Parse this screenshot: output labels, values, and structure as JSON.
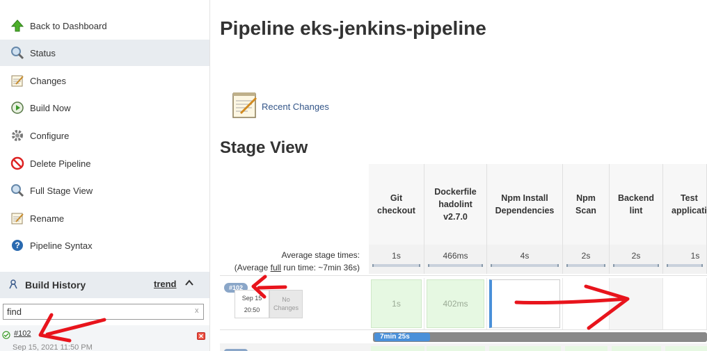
{
  "sidebar": {
    "items": [
      {
        "label": "Back to Dashboard",
        "icon": "up-arrow-icon"
      },
      {
        "label": "Status",
        "icon": "magnifier-icon"
      },
      {
        "label": "Changes",
        "icon": "notepad-icon"
      },
      {
        "label": "Build Now",
        "icon": "clock-play-icon"
      },
      {
        "label": "Configure",
        "icon": "gear-icon"
      },
      {
        "label": "Delete Pipeline",
        "icon": "no-entry-icon"
      },
      {
        "label": "Full Stage View",
        "icon": "magnifier-icon"
      },
      {
        "label": "Rename",
        "icon": "notepad-icon"
      },
      {
        "label": "Pipeline Syntax",
        "icon": "help-icon"
      }
    ],
    "build_history": {
      "title": "Build History",
      "trend": "trend",
      "find_value": "find",
      "find_clear": "x",
      "build_link": "#102",
      "build_date": "Sep 15, 2021 11:50 PM"
    }
  },
  "main": {
    "title": "Pipeline eks-jenkins-pipeline",
    "recent_changes": "Recent Changes",
    "stage_view_title": "Stage View",
    "avg_stage_times_label": "Average stage times:",
    "avg_run_prefix": "(Average ",
    "avg_run_full": "full",
    "avg_run_suffix": " run time: ~7min 36s)",
    "stages": [
      {
        "name": "Git\ncheckout",
        "avg": "1s",
        "cell": "1s",
        "state": "success"
      },
      {
        "name": "Dockerfile\nhadolint\nv2.7.0",
        "avg": "466ms",
        "cell": "402ms",
        "state": "success"
      },
      {
        "name": "Npm Install\nDependencies",
        "avg": "4s",
        "cell": "",
        "state": "running"
      },
      {
        "name": "Npm\nScan",
        "avg": "2s",
        "cell": "",
        "state": "empty"
      },
      {
        "name": "Backend\nlint",
        "avg": "2s",
        "cell": "",
        "state": "empty"
      },
      {
        "name": "Test\napplicati",
        "avg": "1s",
        "cell": "",
        "state": "empty"
      }
    ],
    "build": {
      "number": "#102",
      "date": "Sep 15",
      "time": "20:50",
      "changes": "No\nChanges",
      "duration": "7min 25s"
    }
  },
  "colors": {
    "success_cell": "#e6f8e2",
    "running_accent": "#4a90d9",
    "annotation_red": "#e8141c",
    "badge": "#8aa6c8"
  }
}
